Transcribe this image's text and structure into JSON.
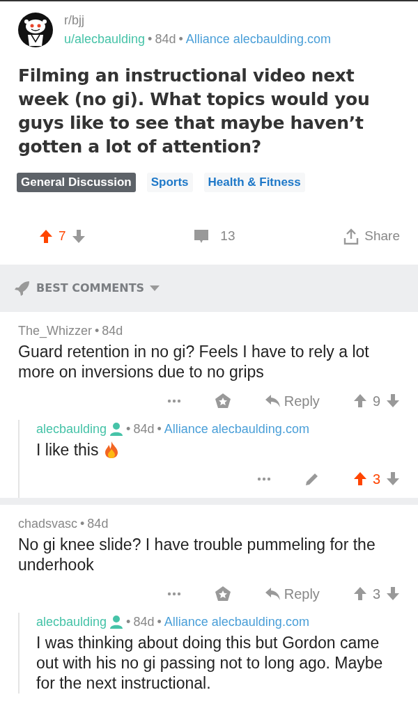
{
  "separator": "•",
  "post": {
    "subreddit": "r/bjj",
    "author": "u/alecbaulding",
    "age": "84d",
    "flair": "Alliance alecbaulding.com",
    "title": "Filming an instructional video next week (no gi). What topics would you guys like to see that maybe haven’t gotten a lot of attention?",
    "tags": [
      {
        "label": "General Discussion",
        "kind": "filled"
      },
      {
        "label": "Sports",
        "kind": "plain"
      },
      {
        "label": "Health & Fitness",
        "kind": "plain"
      }
    ],
    "score": "7",
    "upvoted": true,
    "comments": "13",
    "share": "Share"
  },
  "sort": {
    "label": "BEST COMMENTS"
  },
  "comments": [
    {
      "kind": "top",
      "author": "The_Whizzer",
      "age": "84d",
      "body": "Guard retention in no gi? Feels I have to rely a lot more on inversions due to no grips",
      "reply": "Reply",
      "score": "9",
      "upvoted": false,
      "children": [
        {
          "kind": "reply",
          "author": "alecbaulding",
          "age": "84d",
          "flair": "Alliance alecbaulding.com",
          "body": "I like this",
          "trailing_icon": true,
          "score": "3",
          "upvoted": true
        }
      ]
    },
    {
      "kind": "top",
      "author": "chadsvasc",
      "age": "84d",
      "body": "No gi knee slide? I have trouble pummeling for the underhook",
      "reply": "Reply",
      "score": "3",
      "upvoted": false,
      "children": [
        {
          "kind": "reply",
          "author": "alecbaulding",
          "age": "84d",
          "flair": "Alliance alecbaulding.com",
          "body": "I was thinking about doing this but Gordon came out with his no gi passing not to long ago. Maybe for the next instructional.",
          "trailing_icon": false
        }
      ]
    }
  ]
}
